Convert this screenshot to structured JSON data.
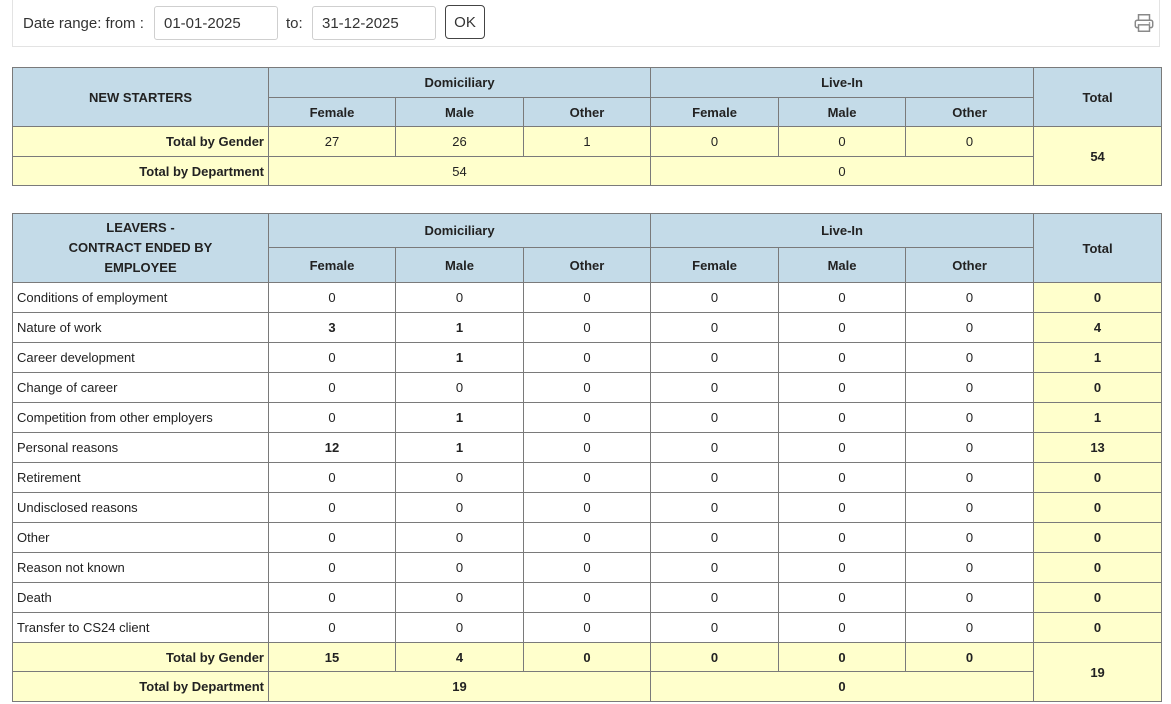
{
  "toolbar": {
    "from_label": "Date range: from :",
    "from_value": "01-01-2025",
    "to_label": "to:",
    "to_value": "31-12-2025",
    "ok_label": "OK",
    "print_icon": "printer-icon"
  },
  "starters": {
    "title": "NEW STARTERS",
    "group1": "Domiciliary",
    "group2": "Live-In",
    "total_header": "Total",
    "col_female": "Female",
    "col_male": "Male",
    "col_other": "Other",
    "row_gender_label": "Total by Gender",
    "row_dept_label": "Total by Department",
    "gender": [
      "27",
      "26",
      "1",
      "0",
      "0",
      "0"
    ],
    "dept": [
      "54",
      "0"
    ],
    "total": "54"
  },
  "leavers": {
    "title_line1": "LEAVERS -",
    "title_line2": "CONTRACT ENDED BY",
    "title_line3": "EMPLOYEE",
    "group1": "Domiciliary",
    "group2": "Live-In",
    "total_header": "Total",
    "col_female": "Female",
    "col_male": "Male",
    "col_other": "Other",
    "rows": [
      {
        "label": "Conditions of employment",
        "values": [
          "0",
          "0",
          "0",
          "0",
          "0",
          "0"
        ],
        "total": "0"
      },
      {
        "label": "Nature of work",
        "values": [
          "3",
          "1",
          "0",
          "0",
          "0",
          "0"
        ],
        "total": "4"
      },
      {
        "label": "Career development",
        "values": [
          "0",
          "1",
          "0",
          "0",
          "0",
          "0"
        ],
        "total": "1"
      },
      {
        "label": "Change of career",
        "values": [
          "0",
          "0",
          "0",
          "0",
          "0",
          "0"
        ],
        "total": "0"
      },
      {
        "label": "Competition from other employers",
        "values": [
          "0",
          "1",
          "0",
          "0",
          "0",
          "0"
        ],
        "total": "1"
      },
      {
        "label": "Personal reasons",
        "values": [
          "12",
          "1",
          "0",
          "0",
          "0",
          "0"
        ],
        "total": "13"
      },
      {
        "label": "Retirement",
        "values": [
          "0",
          "0",
          "0",
          "0",
          "0",
          "0"
        ],
        "total": "0"
      },
      {
        "label": "Undisclosed reasons",
        "values": [
          "0",
          "0",
          "0",
          "0",
          "0",
          "0"
        ],
        "total": "0"
      },
      {
        "label": "Other",
        "values": [
          "0",
          "0",
          "0",
          "0",
          "0",
          "0"
        ],
        "total": "0"
      },
      {
        "label": "Reason not known",
        "values": [
          "0",
          "0",
          "0",
          "0",
          "0",
          "0"
        ],
        "total": "0"
      },
      {
        "label": "Death",
        "values": [
          "0",
          "0",
          "0",
          "0",
          "0",
          "0"
        ],
        "total": "0"
      },
      {
        "label": "Transfer to CS24 client",
        "values": [
          "0",
          "0",
          "0",
          "0",
          "0",
          "0"
        ],
        "total": "0"
      }
    ],
    "row_gender_label": "Total by Gender",
    "row_dept_label": "Total by Department",
    "gender": [
      "15",
      "4",
      "0",
      "0",
      "0",
      "0"
    ],
    "dept": [
      "19",
      "0"
    ],
    "total": "19"
  }
}
